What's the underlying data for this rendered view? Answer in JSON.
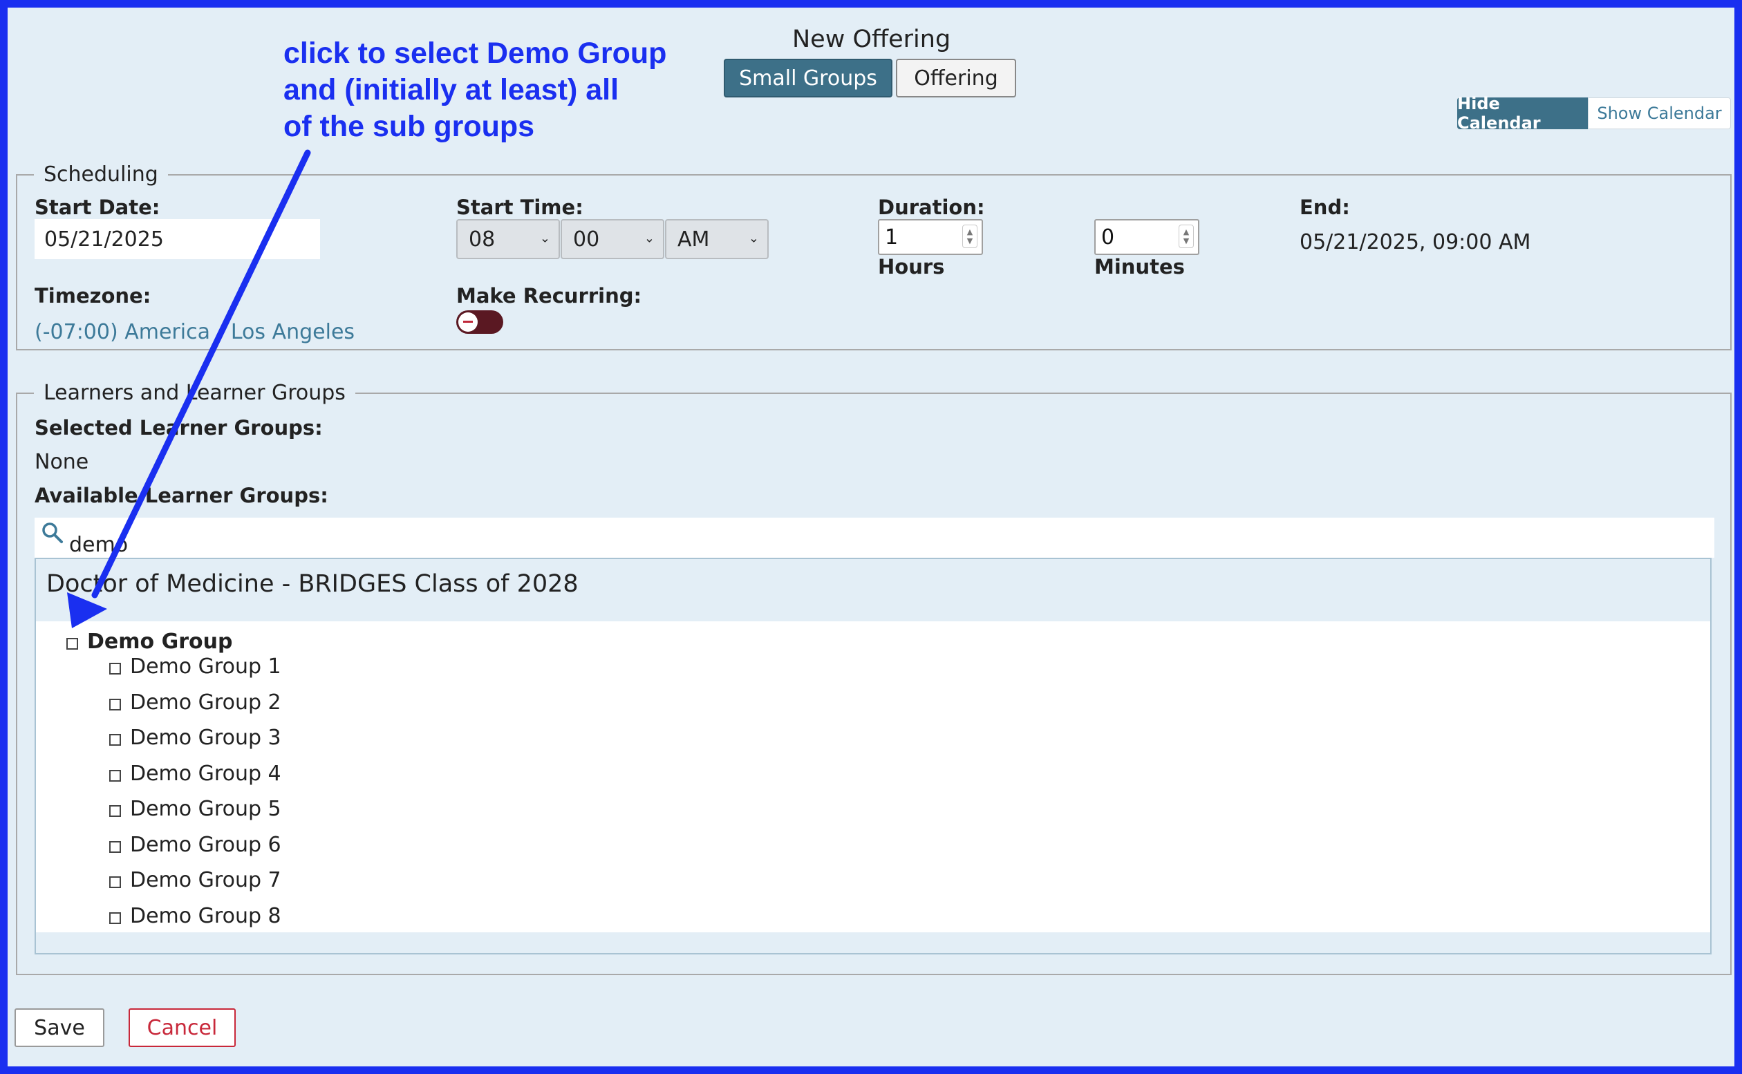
{
  "annotation": {
    "lines": [
      "click to select Demo Group",
      "and (initially at least) all",
      "of the sub groups"
    ]
  },
  "header": {
    "title": "New Offering",
    "tabs": [
      {
        "label": "Small Groups",
        "active": true
      },
      {
        "label": "Offering",
        "active": false
      }
    ],
    "calendar": {
      "hide_label": "Hide Calendar",
      "show_label": "Show Calendar"
    }
  },
  "scheduling": {
    "legend": "Scheduling",
    "start_date_label": "Start Date:",
    "start_date_value": "05/21/2025",
    "start_time_label": "Start Time:",
    "hour": "08",
    "minute": "00",
    "ampm": "AM",
    "duration_label": "Duration:",
    "hours_value": "1",
    "hours_label": "Hours",
    "minutes_value": "0",
    "minutes_label": "Minutes",
    "end_label": "End:",
    "end_value": "05/21/2025, 09:00 AM",
    "timezone_label": "Timezone:",
    "timezone_value": "(-07:00) America - Los Angeles",
    "recurring_label": "Make Recurring:",
    "recurring_on": false
  },
  "learners": {
    "legend": "Learners and Learner Groups",
    "selected_label": "Selected Learner Groups:",
    "selected_value": "None",
    "available_label": "Available Learner Groups:",
    "search_value": "demo",
    "cohort_title": "Doctor of Medicine - BRIDGES Class of 2028",
    "parent_group": "Demo Group",
    "sub_groups": [
      "Demo Group 1",
      "Demo Group 2",
      "Demo Group 3",
      "Demo Group 4",
      "Demo Group 5",
      "Demo Group 6",
      "Demo Group 7",
      "Demo Group 8"
    ]
  },
  "footer": {
    "save_label": "Save",
    "cancel_label": "Cancel"
  },
  "colors": {
    "annotation": "#1a2ff0",
    "active_tab": "#3d7088",
    "link": "#3d7a99",
    "cancel": "#c8283a",
    "page_bg": "#e3eef6"
  }
}
